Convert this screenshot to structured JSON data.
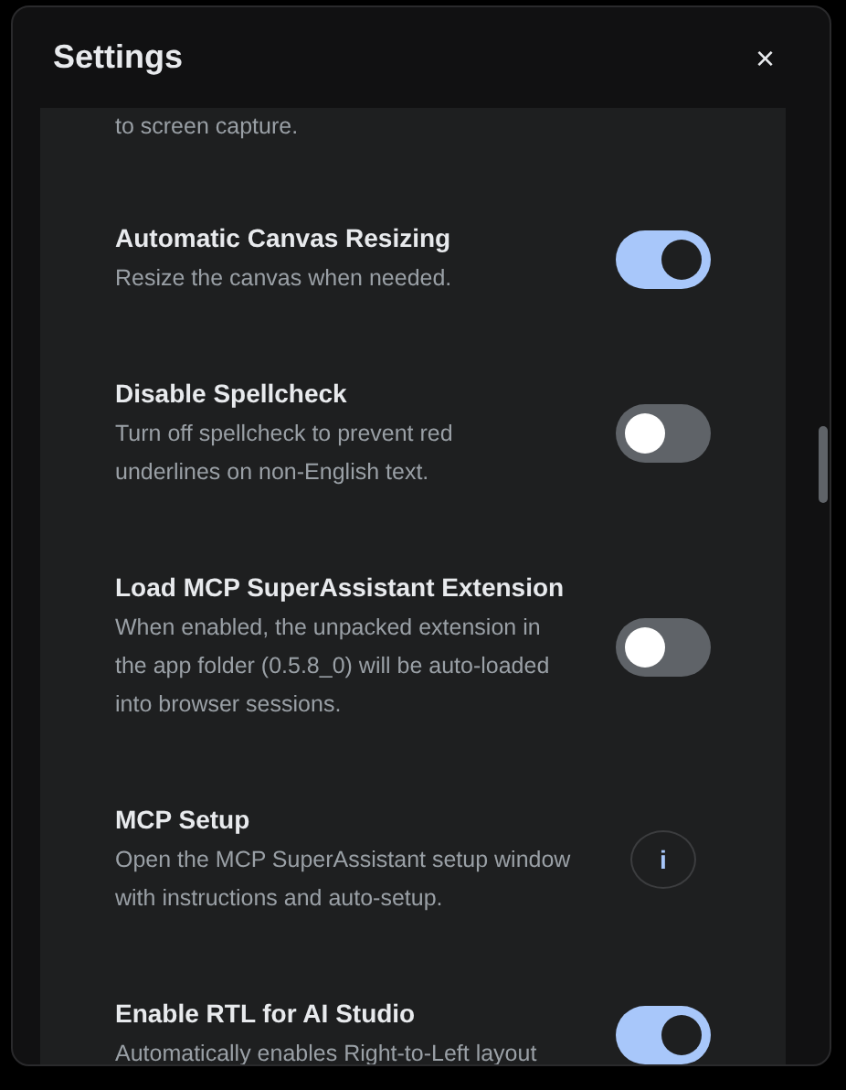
{
  "dialog": {
    "title": "Settings",
    "close": "×"
  },
  "settings": [
    {
      "kind": "partial",
      "description": [
        "to screen capture."
      ]
    },
    {
      "kind": "toggle",
      "title": "Automatic Canvas Resizing",
      "description": [
        "Resize the canvas when needed."
      ],
      "on": true
    },
    {
      "kind": "toggle",
      "title": "Disable Spellcheck",
      "description": [
        "Turn off spellcheck to prevent red",
        "underlines on non-English text."
      ],
      "on": false
    },
    {
      "kind": "toggle",
      "title": "Load MCP SuperAssistant Extension",
      "description": [
        "When enabled, the unpacked extension in",
        "the app folder (0.5.8_0) will be auto-loaded",
        "into browser sessions."
      ],
      "on": false
    },
    {
      "kind": "info",
      "title": "MCP Setup",
      "description": [
        "Open the MCP SuperAssistant setup window",
        "with instructions and auto-setup."
      ],
      "button": "i"
    },
    {
      "kind": "toggle",
      "title": "Enable RTL for AI Studio",
      "description": [
        "Automatically enables Right-to-Left layout"
      ],
      "on": true
    }
  ]
}
